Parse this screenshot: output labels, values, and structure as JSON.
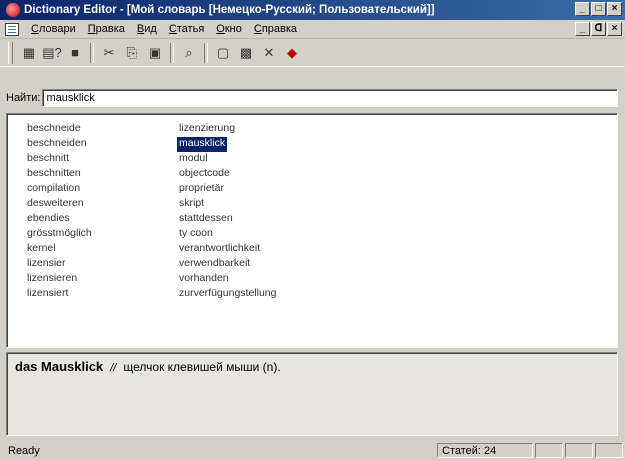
{
  "window": {
    "title": "Dictionary Editor - [Мой словарь [Немецко-Русский; Пользовательский]]",
    "minimize": "_",
    "maximize": "□",
    "close": "×"
  },
  "doc_controls": {
    "minimize": "_",
    "restore": "ᗡ",
    "close": "×"
  },
  "menu": [
    "Словари",
    "Правка",
    "Вид",
    "Статья",
    "Окно",
    "Справка"
  ],
  "toolbar_icons": [
    "dictionaries-icon",
    "help-icon",
    "save-icon",
    "cut-icon",
    "copy-icon",
    "paste-icon",
    "find-icon",
    "new-entry-icon",
    "edit-entry-icon",
    "delete-icon",
    "properties-icon"
  ],
  "search": {
    "label": "Найти:",
    "value": "mausklick"
  },
  "entries": [
    {
      "left": "beschneide",
      "right": "lizenzierung"
    },
    {
      "left": "beschneiden",
      "right": "mausklick",
      "selected": true
    },
    {
      "left": "beschnitt",
      "right": "modul"
    },
    {
      "left": "beschnitten",
      "right": "objectcode"
    },
    {
      "left": "compilation",
      "right": "proprietär"
    },
    {
      "left": "desweiteren",
      "right": "skript"
    },
    {
      "left": "ebendies",
      "right": "stattdessen"
    },
    {
      "left": "grösstmöglich",
      "right": "ty coon"
    },
    {
      "left": "kernel",
      "right": "verantwortlichkeit"
    },
    {
      "left": "lizensier",
      "right": "verwendbarkeit"
    },
    {
      "left": "lizensieren",
      "right": "vorhanden"
    },
    {
      "left": "lizensiert",
      "right": "zurverfügungstellung"
    }
  ],
  "detail": {
    "word": "das Mausklick",
    "separator": "//",
    "translation": "щелчок клевишей мыши (n)."
  },
  "status": {
    "text": "Ready",
    "count": "Статей: 24"
  },
  "colors": {
    "title_bar": "#0a246a",
    "selection": "#0a246a",
    "chrome": "#d4d0c8"
  }
}
